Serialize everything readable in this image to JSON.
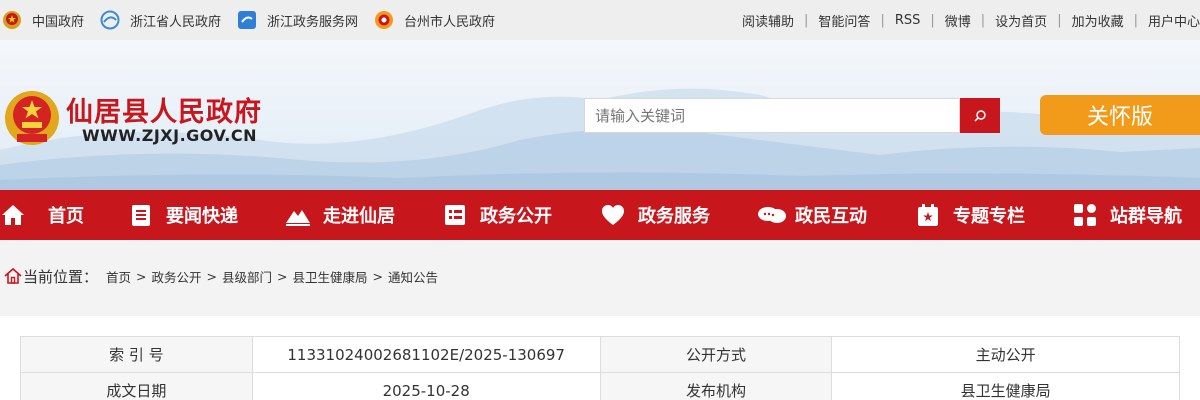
{
  "topbar": {
    "links": [
      {
        "label": "中国政府",
        "icon": "national-emblem-icon"
      },
      {
        "label": "浙江省人民政府",
        "icon": "zhejiang-gov-icon"
      },
      {
        "label": "浙江政务服务网",
        "icon": "zhejiang-service-icon"
      },
      {
        "label": "台州市人民政府",
        "icon": "taizhou-gov-icon"
      }
    ],
    "utilities": [
      "阅读辅助",
      "智能问答",
      "RSS",
      "微博",
      "设为首页",
      "加为收藏",
      "用户中心"
    ]
  },
  "header": {
    "site_name": "仙居县人民政府",
    "domain": "WWW.ZJXJ.GOV.CN",
    "search_placeholder": "请输入关键词",
    "care_label": "关怀版"
  },
  "nav": {
    "items": [
      {
        "label": "首页",
        "icon": "home-icon"
      },
      {
        "label": "要闻快递",
        "icon": "news-icon"
      },
      {
        "label": "走进仙居",
        "icon": "mountain-icon"
      },
      {
        "label": "政务公开",
        "icon": "document-icon"
      },
      {
        "label": "政务服务",
        "icon": "heart-icon"
      },
      {
        "label": "政民互动",
        "icon": "chat-icon"
      },
      {
        "label": "专题专栏",
        "icon": "topic-icon"
      },
      {
        "label": "站群导航",
        "icon": "grid-icon"
      }
    ]
  },
  "breadcrumb": {
    "label": "当前位置：",
    "items": [
      "首页",
      "政务公开",
      "县级部门",
      "县卫生健康局",
      "通知公告"
    ]
  },
  "meta_table": {
    "rows": [
      [
        "索 引 号",
        "11331024002681102E/2025-130697",
        "公开方式",
        "主动公开"
      ],
      [
        "成文日期",
        "2025-10-28",
        "发布机构",
        "县卫生健康局"
      ]
    ]
  },
  "colors": {
    "brand_red": "#c8161d",
    "care_orange": "#f29b1a"
  }
}
